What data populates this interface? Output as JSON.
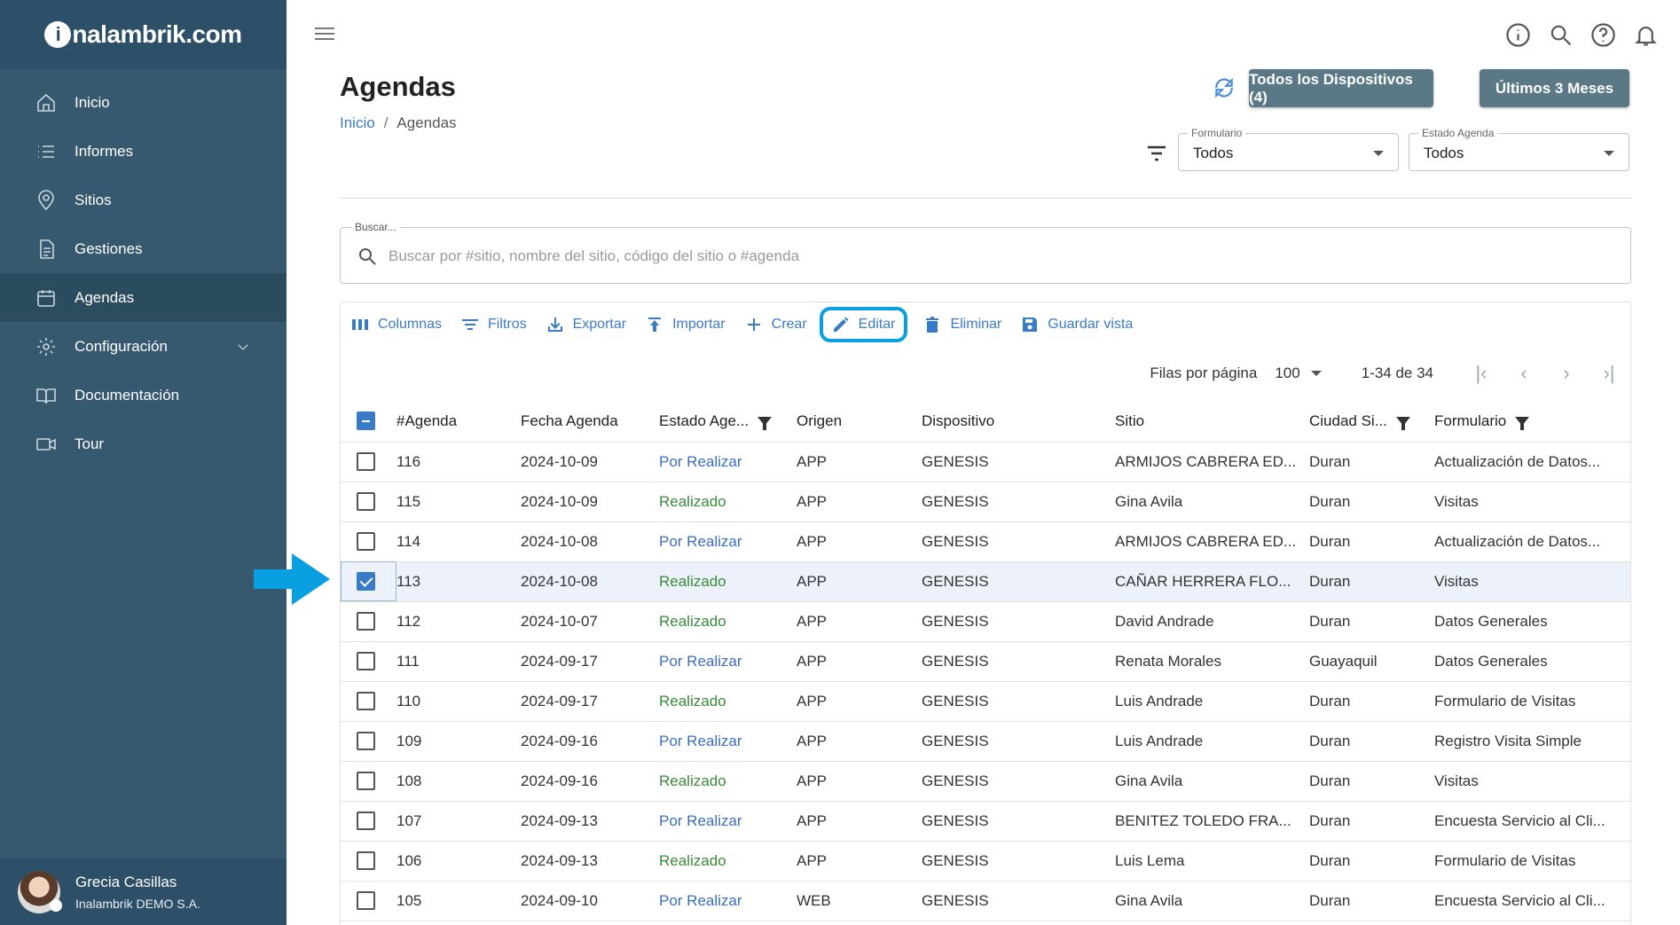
{
  "app": {
    "logo_text": "nalambrik.com",
    "logo_i": "i"
  },
  "sidebar": {
    "items": [
      {
        "label": "Inicio",
        "icon": "home-icon"
      },
      {
        "label": "Informes",
        "icon": "list-icon"
      },
      {
        "label": "Sitios",
        "icon": "location-icon"
      },
      {
        "label": "Gestiones",
        "icon": "document-icon"
      },
      {
        "label": "Agendas",
        "icon": "calendar-icon",
        "active": true
      },
      {
        "label": "Configuración",
        "icon": "gear-icon",
        "expandable": true
      },
      {
        "label": "Documentación",
        "icon": "book-icon"
      },
      {
        "label": "Tour",
        "icon": "video-icon"
      }
    ]
  },
  "user": {
    "name": "Grecia Casillas",
    "org": "Inalambrik DEMO S.A."
  },
  "header": {
    "title": "Agendas",
    "breadcrumb": {
      "home": "Inicio",
      "sep": "/",
      "current": "Agendas"
    },
    "btn_devices": "Todos los Dispositivos (4)",
    "btn_months": "Últimos 3 Meses"
  },
  "filters": {
    "formulario": {
      "label": "Formulario",
      "value": "Todos"
    },
    "estado": {
      "label": "Estado Agenda",
      "value": "Todos"
    }
  },
  "search": {
    "label": "Buscar...",
    "placeholder": "Buscar por #sitio, nombre del sitio, código del sitio o #agenda"
  },
  "toolbar": {
    "columnas": "Columnas",
    "filtros": "Filtros",
    "exportar": "Exportar",
    "importar": "Importar",
    "crear": "Crear",
    "editar": "Editar",
    "eliminar": "Eliminar",
    "guardar": "Guardar vista"
  },
  "pager": {
    "rows_label": "Filas por página",
    "rows_value": "100",
    "count": "1-34 de 34"
  },
  "table": {
    "columns": [
      "#Agenda",
      "Fecha Agenda",
      "Estado Age...",
      "Origen",
      "Dispositivo",
      "Sitio",
      "Ciudad Si...",
      "Formulario"
    ],
    "rows": [
      [
        "116",
        "2024-10-09",
        "Por Realizar",
        "APP",
        "GENESIS",
        "ARMIJOS CABRERA ED...",
        "Duran",
        "Actualización de Datos..."
      ],
      [
        "115",
        "2024-10-09",
        "Realizado",
        "APP",
        "GENESIS",
        "Gina Avila",
        "Duran",
        "Visitas"
      ],
      [
        "114",
        "2024-10-08",
        "Por Realizar",
        "APP",
        "GENESIS",
        "ARMIJOS CABRERA ED...",
        "Duran",
        "Actualización de Datos..."
      ],
      [
        "113",
        "2024-10-08",
        "Realizado",
        "APP",
        "GENESIS",
        "CAÑAR HERRERA FLO...",
        "Duran",
        "Visitas"
      ],
      [
        "112",
        "2024-10-07",
        "Realizado",
        "APP",
        "GENESIS",
        "David Andrade",
        "Duran",
        "Datos Generales"
      ],
      [
        "111",
        "2024-09-17",
        "Por Realizar",
        "APP",
        "GENESIS",
        "Renata Morales",
        "Guayaquil",
        "Datos Generales"
      ],
      [
        "110",
        "2024-09-17",
        "Realizado",
        "APP",
        "GENESIS",
        "Luis Andrade",
        "Duran",
        "Formulario de Visitas"
      ],
      [
        "109",
        "2024-09-16",
        "Por Realizar",
        "APP",
        "GENESIS",
        "Luis Andrade",
        "Duran",
        "Registro Visita Simple"
      ],
      [
        "108",
        "2024-09-16",
        "Realizado",
        "APP",
        "GENESIS",
        "Gina Avila",
        "Duran",
        "Visitas"
      ],
      [
        "107",
        "2024-09-13",
        "Por Realizar",
        "APP",
        "GENESIS",
        "BENITEZ TOLEDO FRA...",
        "Duran",
        "Encuesta Servicio al Cli..."
      ],
      [
        "106",
        "2024-09-13",
        "Realizado",
        "APP",
        "GENESIS",
        "Luis Lema",
        "Duran",
        "Formulario de Visitas"
      ],
      [
        "105",
        "2024-09-10",
        "Por Realizar",
        "WEB",
        "GENESIS",
        "Gina Avila",
        "Duran",
        "Encuesta Servicio al Cli..."
      ]
    ],
    "selected_row": 3
  },
  "colors": {
    "sidebar": "#36596f",
    "accent": "#3a7bc8",
    "highlight": "#0a9fe0",
    "por_realizar": "#3a6fc0",
    "realizado": "#3a8a3a"
  }
}
